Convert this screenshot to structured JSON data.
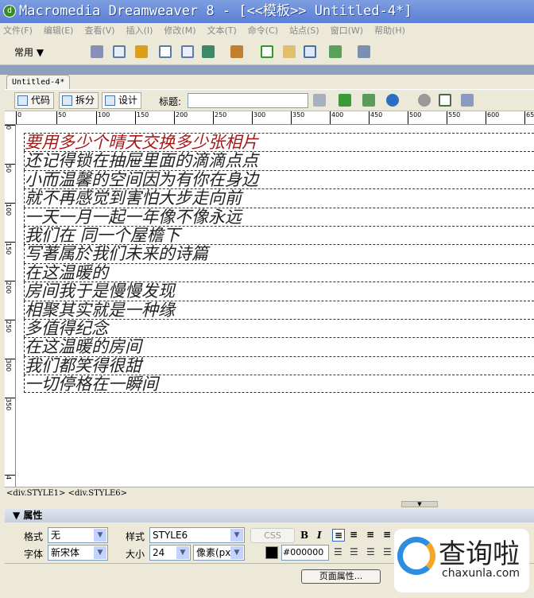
{
  "window": {
    "title": "Macromedia Dreamweaver 8 - [<<模板>> Untitled-4*]"
  },
  "menu": [
    "文件(F)",
    "编辑(E)",
    "查看(V)",
    "插入(I)",
    "修改(M)",
    "文本(T)",
    "命令(C)",
    "站点(S)",
    "窗口(W)",
    "帮助(H)"
  ],
  "insert_toolbar": {
    "category": "常用 ▼"
  },
  "document": {
    "tab": "Untitled-4*",
    "view_code": "代码",
    "view_split": "拆分",
    "view_design": "设计",
    "title_label": "标题:",
    "title_value": ""
  },
  "ruler_h": [
    "0",
    "50",
    "100",
    "150",
    "200",
    "250",
    "300",
    "350",
    "400",
    "450",
    "500",
    "550",
    "600",
    "65"
  ],
  "ruler_v": [
    "0",
    "50",
    "100",
    "150",
    "200",
    "250",
    "300",
    "350",
    "4"
  ],
  "lyrics": [
    "要用多少个晴天交换多少张相片",
    "还记得锁在抽屉里面的滴滴点点",
    "小而温馨的空间因为有你在身边",
    "就不再感觉到害怕大步走向前",
    "一天一月一起一年像不像永远",
    "我们在 同一个屋檐下",
    "写著属於我们未来的诗篇",
    "在这温暖的",
    "房间我于是慢慢发现",
    "相聚其实就是一种缘",
    "多值得纪念",
    "在这温暖的房间",
    "我们都笑得很甜",
    "一切停格在一瞬间"
  ],
  "status": {
    "tag_path": "<div.STYLE1> <div.STYLE6>"
  },
  "properties": {
    "header": "▼ 属性",
    "format_label": "格式",
    "format_value": "无",
    "style_label": "样式",
    "style_value": "STYLE6",
    "css_button": "CSS",
    "font_label": "字体",
    "font_value": "新宋体",
    "size_label": "大小",
    "size_value": "24",
    "unit_value": "像素(px",
    "color_value": "#000000",
    "page_props_button": "页面属性...",
    "bold": "B",
    "italic": "I"
  },
  "watermark": {
    "text": "查询啦",
    "url": "chaxunla.com"
  },
  "colors": {
    "first_line": "#a01818",
    "titlebar": "#5b7fd6"
  }
}
